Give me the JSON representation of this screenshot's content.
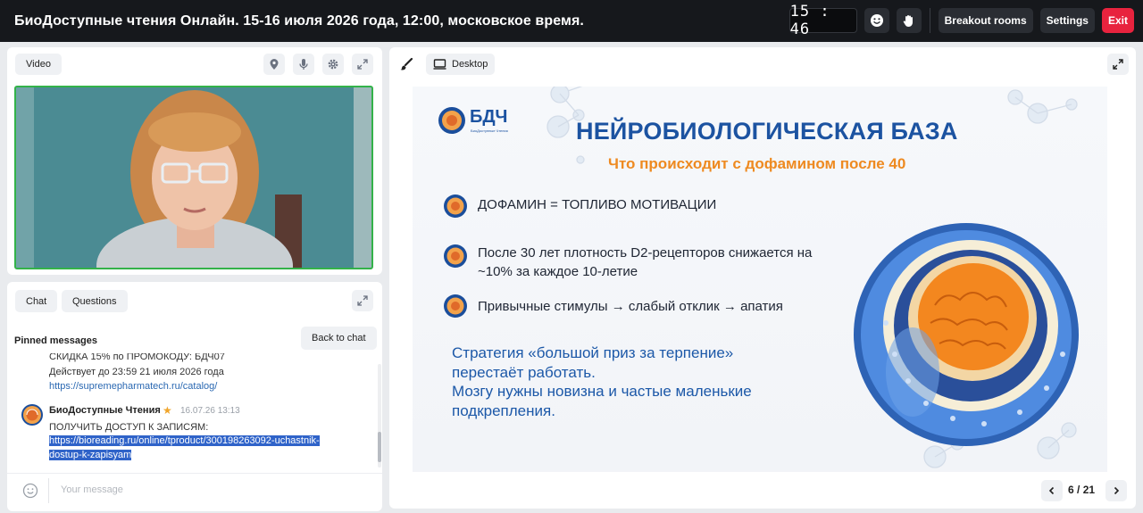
{
  "header": {
    "title": "БиоДоступные чтения Онлайн. 15-16 июля 2026 года, 12:00, московское время.",
    "timer": "15 : 46",
    "icons": [
      "smile-icon",
      "hand-icon"
    ],
    "breakout_label": "Breakout rooms",
    "settings_label": "Settings",
    "exit_label": "Exit",
    "exit_color": "#e8233e"
  },
  "video": {
    "tab_label": "Video",
    "icons": [
      "location-pin-icon",
      "microphone-icon",
      "gear-icon",
      "expand-icon"
    ],
    "border_color": "#33b249"
  },
  "chat": {
    "tabs": [
      "Chat",
      "Questions"
    ],
    "pinned_label": "Pinned messages",
    "back_label": "Back to chat",
    "messages": [
      {
        "lines": [
          "СКИДКА 15% по ПРОМОКОДУ: БДЧ07",
          "Действует до 23:59 21 июля 2026 года"
        ],
        "link": "https://supremepharmatech.ru/catalog/"
      },
      {
        "author": "БиоДоступные Чтения",
        "star": "★",
        "time": "16.07.26 13:13",
        "text": "ПОЛУЧИТЬ ДОСТУП К ЗАПИСЯМ:",
        "link_line1": "https://bioreading.ru/online/tproduct/300198263092-uchastnik-",
        "link_line2": "dostup-k-zapisyam"
      }
    ],
    "input_placeholder": "Your message"
  },
  "presentation": {
    "desktop_label": "Desktop",
    "slide": {
      "logo_text": "БДЧ",
      "logo_caption": "БиоДоступные Чтения",
      "title": "НЕЙРОБИОЛОГИЧЕСКАЯ БАЗА",
      "subtitle": "Что происходит с дофамином после 40",
      "bullets": [
        "ДОФАМИН = ТОПЛИВО МОТИВАЦИИ",
        "После 30 лет плотность D2-рецепторов снижается на",
        "~10% за каждое 10-летие",
        "Привычные стимулы → слабый отклик → апатия"
      ],
      "strategy_lines": [
        "Стратегия «большой приз за терпение»",
        "перестаёт работать.",
        "Мозгу нужны новизна и частые маленькие",
        "подкрепления."
      ]
    },
    "pagination": {
      "current": "6",
      "separator": "/",
      "total": "21"
    }
  },
  "colors": {
    "accent_blue": "#1c53a1",
    "accent_orange": "#ee8a20",
    "link": "#2a68b2",
    "selection": "#2f63c9"
  }
}
